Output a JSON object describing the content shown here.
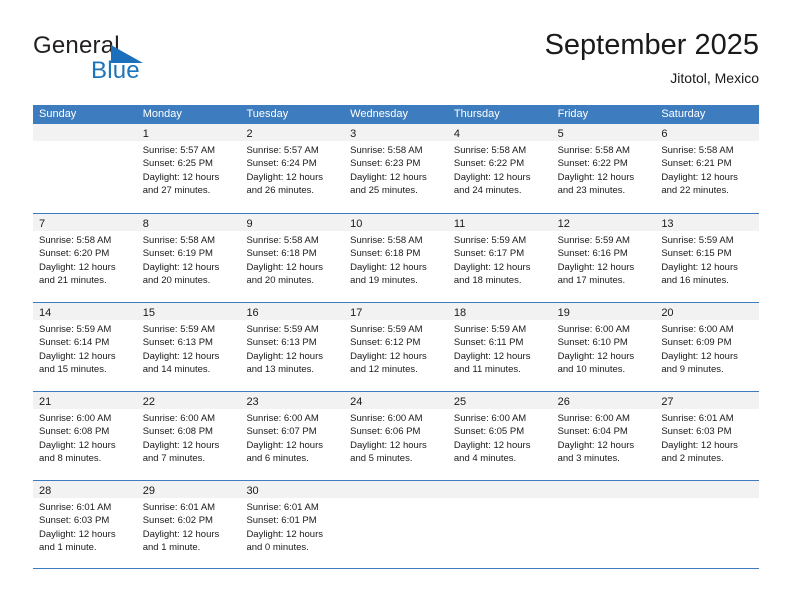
{
  "brand": {
    "name_top": "General",
    "name_bottom": "Blue",
    "triangle_color": "#1c6fba",
    "blue_color": "#1c75bc"
  },
  "header": {
    "title": "September 2025",
    "subtitle": "Jitotol, Mexico"
  },
  "theme": {
    "header_bar_color": "#3d7dbf",
    "day_number_band_color": "#f2f2f2",
    "text_color": "#1a1a1a"
  },
  "calendar": {
    "weekdays": [
      "Sunday",
      "Monday",
      "Tuesday",
      "Wednesday",
      "Thursday",
      "Friday",
      "Saturday"
    ],
    "weeks": [
      [
        {
          "day": "",
          "lines": []
        },
        {
          "day": "1",
          "lines": [
            "Sunrise: 5:57 AM",
            "Sunset: 6:25 PM",
            "Daylight: 12 hours",
            "and 27 minutes."
          ]
        },
        {
          "day": "2",
          "lines": [
            "Sunrise: 5:57 AM",
            "Sunset: 6:24 PM",
            "Daylight: 12 hours",
            "and 26 minutes."
          ]
        },
        {
          "day": "3",
          "lines": [
            "Sunrise: 5:58 AM",
            "Sunset: 6:23 PM",
            "Daylight: 12 hours",
            "and 25 minutes."
          ]
        },
        {
          "day": "4",
          "lines": [
            "Sunrise: 5:58 AM",
            "Sunset: 6:22 PM",
            "Daylight: 12 hours",
            "and 24 minutes."
          ]
        },
        {
          "day": "5",
          "lines": [
            "Sunrise: 5:58 AM",
            "Sunset: 6:22 PM",
            "Daylight: 12 hours",
            "and 23 minutes."
          ]
        },
        {
          "day": "6",
          "lines": [
            "Sunrise: 5:58 AM",
            "Sunset: 6:21 PM",
            "Daylight: 12 hours",
            "and 22 minutes."
          ]
        }
      ],
      [
        {
          "day": "7",
          "lines": [
            "Sunrise: 5:58 AM",
            "Sunset: 6:20 PM",
            "Daylight: 12 hours",
            "and 21 minutes."
          ]
        },
        {
          "day": "8",
          "lines": [
            "Sunrise: 5:58 AM",
            "Sunset: 6:19 PM",
            "Daylight: 12 hours",
            "and 20 minutes."
          ]
        },
        {
          "day": "9",
          "lines": [
            "Sunrise: 5:58 AM",
            "Sunset: 6:18 PM",
            "Daylight: 12 hours",
            "and 20 minutes."
          ]
        },
        {
          "day": "10",
          "lines": [
            "Sunrise: 5:58 AM",
            "Sunset: 6:18 PM",
            "Daylight: 12 hours",
            "and 19 minutes."
          ]
        },
        {
          "day": "11",
          "lines": [
            "Sunrise: 5:59 AM",
            "Sunset: 6:17 PM",
            "Daylight: 12 hours",
            "and 18 minutes."
          ]
        },
        {
          "day": "12",
          "lines": [
            "Sunrise: 5:59 AM",
            "Sunset: 6:16 PM",
            "Daylight: 12 hours",
            "and 17 minutes."
          ]
        },
        {
          "day": "13",
          "lines": [
            "Sunrise: 5:59 AM",
            "Sunset: 6:15 PM",
            "Daylight: 12 hours",
            "and 16 minutes."
          ]
        }
      ],
      [
        {
          "day": "14",
          "lines": [
            "Sunrise: 5:59 AM",
            "Sunset: 6:14 PM",
            "Daylight: 12 hours",
            "and 15 minutes."
          ]
        },
        {
          "day": "15",
          "lines": [
            "Sunrise: 5:59 AM",
            "Sunset: 6:13 PM",
            "Daylight: 12 hours",
            "and 14 minutes."
          ]
        },
        {
          "day": "16",
          "lines": [
            "Sunrise: 5:59 AM",
            "Sunset: 6:13 PM",
            "Daylight: 12 hours",
            "and 13 minutes."
          ]
        },
        {
          "day": "17",
          "lines": [
            "Sunrise: 5:59 AM",
            "Sunset: 6:12 PM",
            "Daylight: 12 hours",
            "and 12 minutes."
          ]
        },
        {
          "day": "18",
          "lines": [
            "Sunrise: 5:59 AM",
            "Sunset: 6:11 PM",
            "Daylight: 12 hours",
            "and 11 minutes."
          ]
        },
        {
          "day": "19",
          "lines": [
            "Sunrise: 6:00 AM",
            "Sunset: 6:10 PM",
            "Daylight: 12 hours",
            "and 10 minutes."
          ]
        },
        {
          "day": "20",
          "lines": [
            "Sunrise: 6:00 AM",
            "Sunset: 6:09 PM",
            "Daylight: 12 hours",
            "and 9 minutes."
          ]
        }
      ],
      [
        {
          "day": "21",
          "lines": [
            "Sunrise: 6:00 AM",
            "Sunset: 6:08 PM",
            "Daylight: 12 hours",
            "and 8 minutes."
          ]
        },
        {
          "day": "22",
          "lines": [
            "Sunrise: 6:00 AM",
            "Sunset: 6:08 PM",
            "Daylight: 12 hours",
            "and 7 minutes."
          ]
        },
        {
          "day": "23",
          "lines": [
            "Sunrise: 6:00 AM",
            "Sunset: 6:07 PM",
            "Daylight: 12 hours",
            "and 6 minutes."
          ]
        },
        {
          "day": "24",
          "lines": [
            "Sunrise: 6:00 AM",
            "Sunset: 6:06 PM",
            "Daylight: 12 hours",
            "and 5 minutes."
          ]
        },
        {
          "day": "25",
          "lines": [
            "Sunrise: 6:00 AM",
            "Sunset: 6:05 PM",
            "Daylight: 12 hours",
            "and 4 minutes."
          ]
        },
        {
          "day": "26",
          "lines": [
            "Sunrise: 6:00 AM",
            "Sunset: 6:04 PM",
            "Daylight: 12 hours",
            "and 3 minutes."
          ]
        },
        {
          "day": "27",
          "lines": [
            "Sunrise: 6:01 AM",
            "Sunset: 6:03 PM",
            "Daylight: 12 hours",
            "and 2 minutes."
          ]
        }
      ],
      [
        {
          "day": "28",
          "lines": [
            "Sunrise: 6:01 AM",
            "Sunset: 6:03 PM",
            "Daylight: 12 hours",
            "and 1 minute."
          ]
        },
        {
          "day": "29",
          "lines": [
            "Sunrise: 6:01 AM",
            "Sunset: 6:02 PM",
            "Daylight: 12 hours",
            "and 1 minute."
          ]
        },
        {
          "day": "30",
          "lines": [
            "Sunrise: 6:01 AM",
            "Sunset: 6:01 PM",
            "Daylight: 12 hours",
            "and 0 minutes."
          ]
        },
        {
          "day": "",
          "lines": []
        },
        {
          "day": "",
          "lines": []
        },
        {
          "day": "",
          "lines": []
        },
        {
          "day": "",
          "lines": []
        }
      ]
    ]
  }
}
